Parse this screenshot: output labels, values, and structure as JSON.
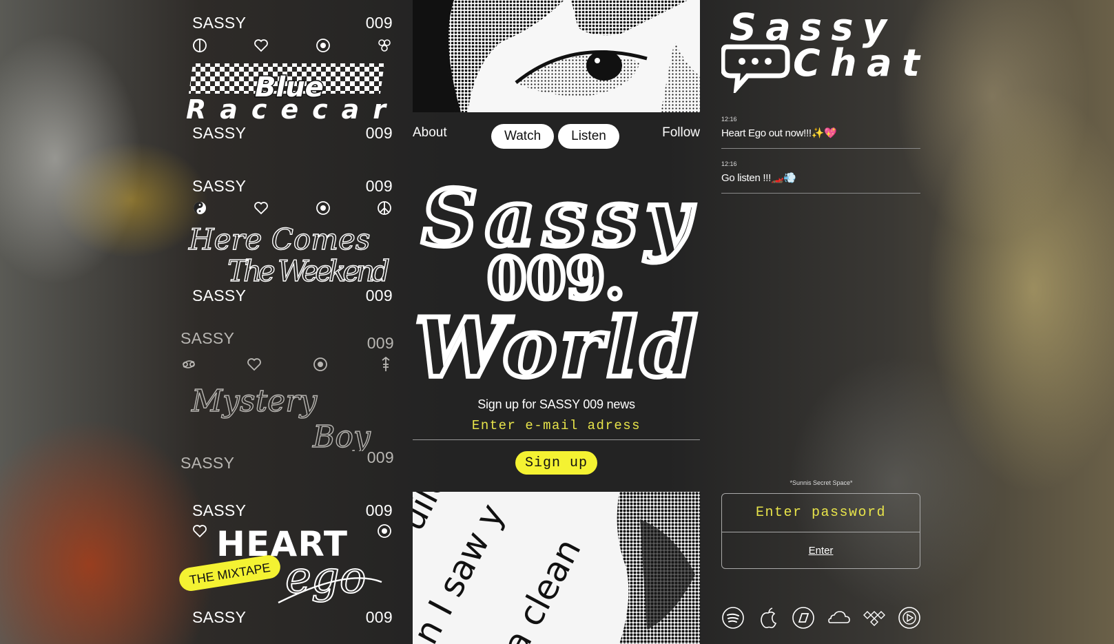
{
  "cards": [
    {
      "brand": "SASSY",
      "number": "009",
      "title_line1": "Blue",
      "title_line2": "Racecar"
    },
    {
      "brand": "SASSY",
      "number": "009",
      "title_line1": "Here Comes",
      "title_line2": "The Weekend"
    },
    {
      "brand": "SASSY",
      "number": "009",
      "title_line1": "Mystery",
      "title_line2": "Boy"
    },
    {
      "brand": "SASSY",
      "number": "009",
      "title_line1": "HEART",
      "title_line2": "ego",
      "tag": "THE MIXTAPE"
    }
  ],
  "nav": {
    "about": "About",
    "watch": "Watch",
    "listen": "Listen",
    "follow": "Follow"
  },
  "main_logo": {
    "line1": "Sassy",
    "line2": "009.",
    "line3": "World"
  },
  "signup": {
    "title": "Sign up for SASSY 009 news",
    "email_placeholder": "Enter e-mail adress",
    "button": "Sign up"
  },
  "photo_text": [
    "n I saw y",
    "a clean",
    "uildi"
  ],
  "chat": {
    "logo_line1": "Sassy",
    "logo_line2": "Chat",
    "messages": [
      {
        "time": "12:16",
        "text": "Heart Ego out now!!!✨💖"
      },
      {
        "time": "12:16",
        "text": "Go listen !!!🏎️💨"
      }
    ]
  },
  "secret": {
    "label": "*Sunnis Secret Space*",
    "password_placeholder": "Enter password",
    "enter": "Enter"
  },
  "services": [
    "spotify-icon",
    "apple-music-icon",
    "deezer-icon",
    "soundcloud-icon",
    "tidal-icon",
    "youtube-music-icon"
  ],
  "colors": {
    "accent_yellow": "#f4f232",
    "background": "#232323"
  }
}
